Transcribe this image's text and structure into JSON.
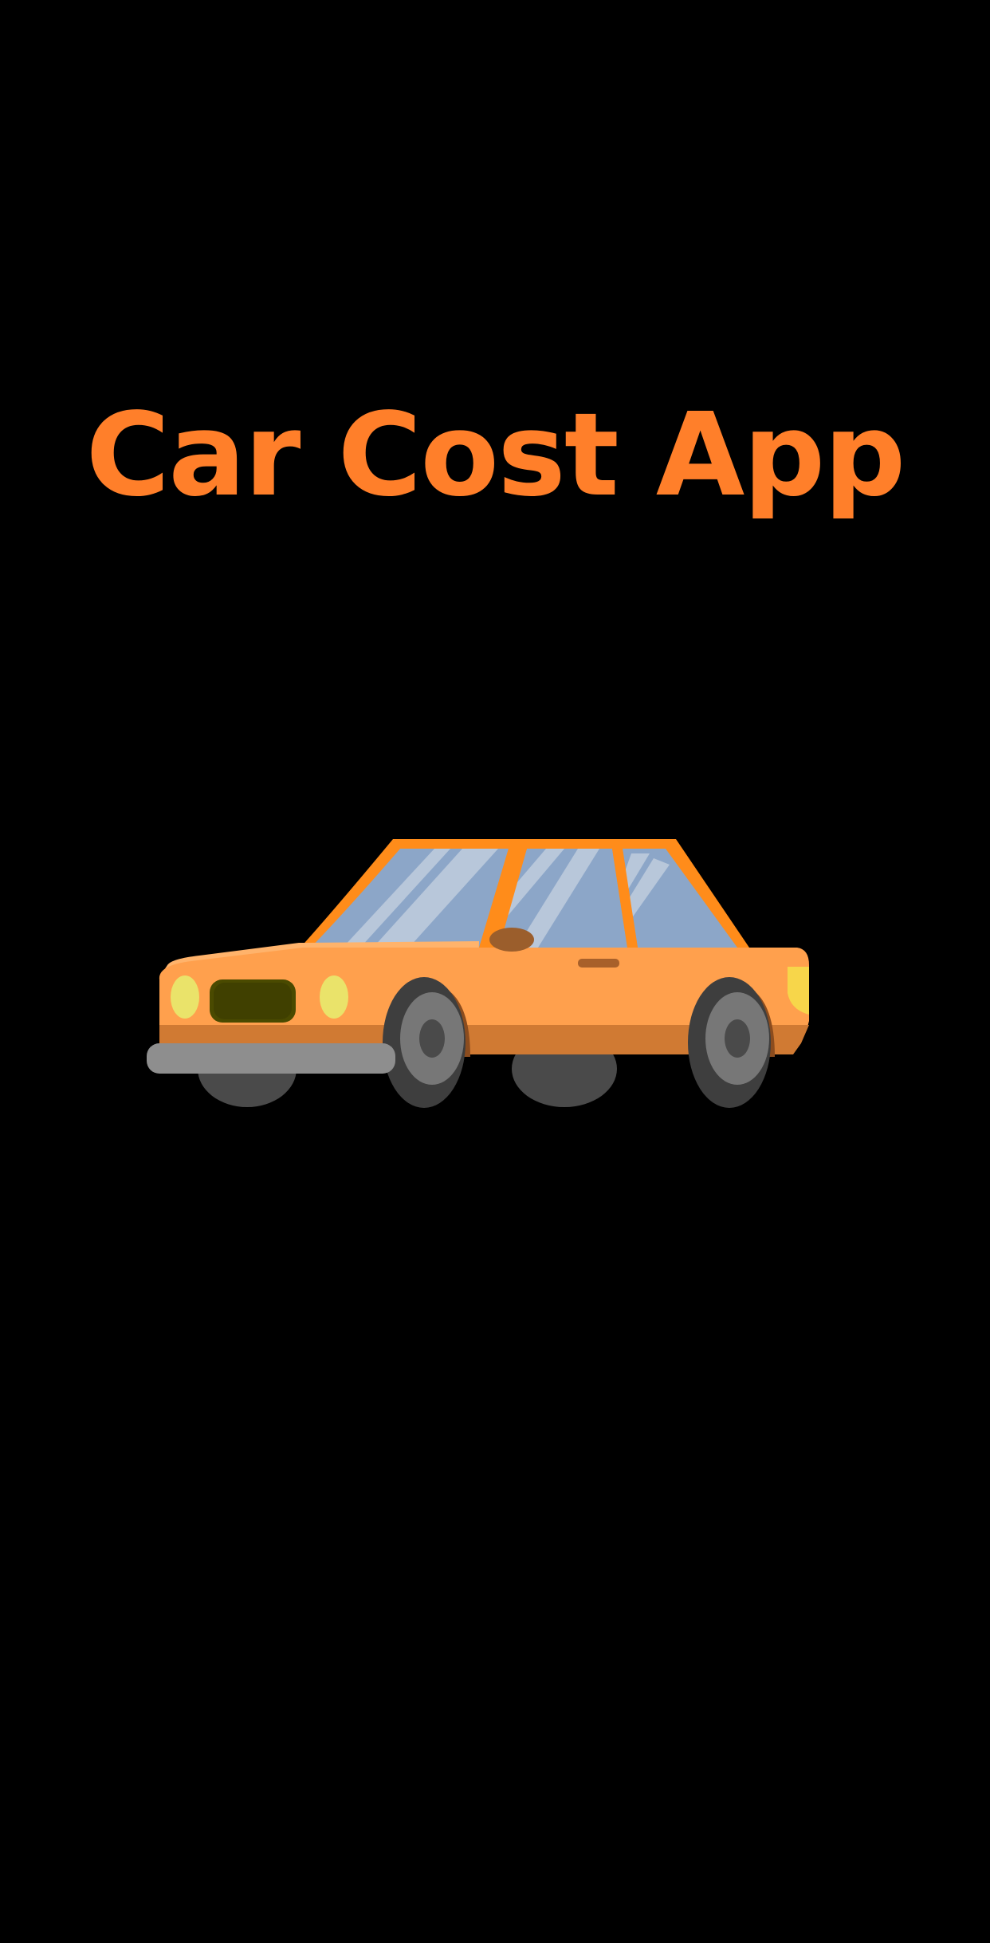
{
  "splash": {
    "title": "Car Cost App",
    "illustration_icon": "car-icon"
  },
  "colors": {
    "background": "#000000",
    "title": "#FF7F2A",
    "car_body": "#FFA04D",
    "car_roof": "#FF8C1A",
    "window": "#8CA6C8",
    "headlight": "#EAE36A",
    "grille": "#4A4A00",
    "tire": "#4A4A4A",
    "bumper": "#8E8E8E"
  }
}
